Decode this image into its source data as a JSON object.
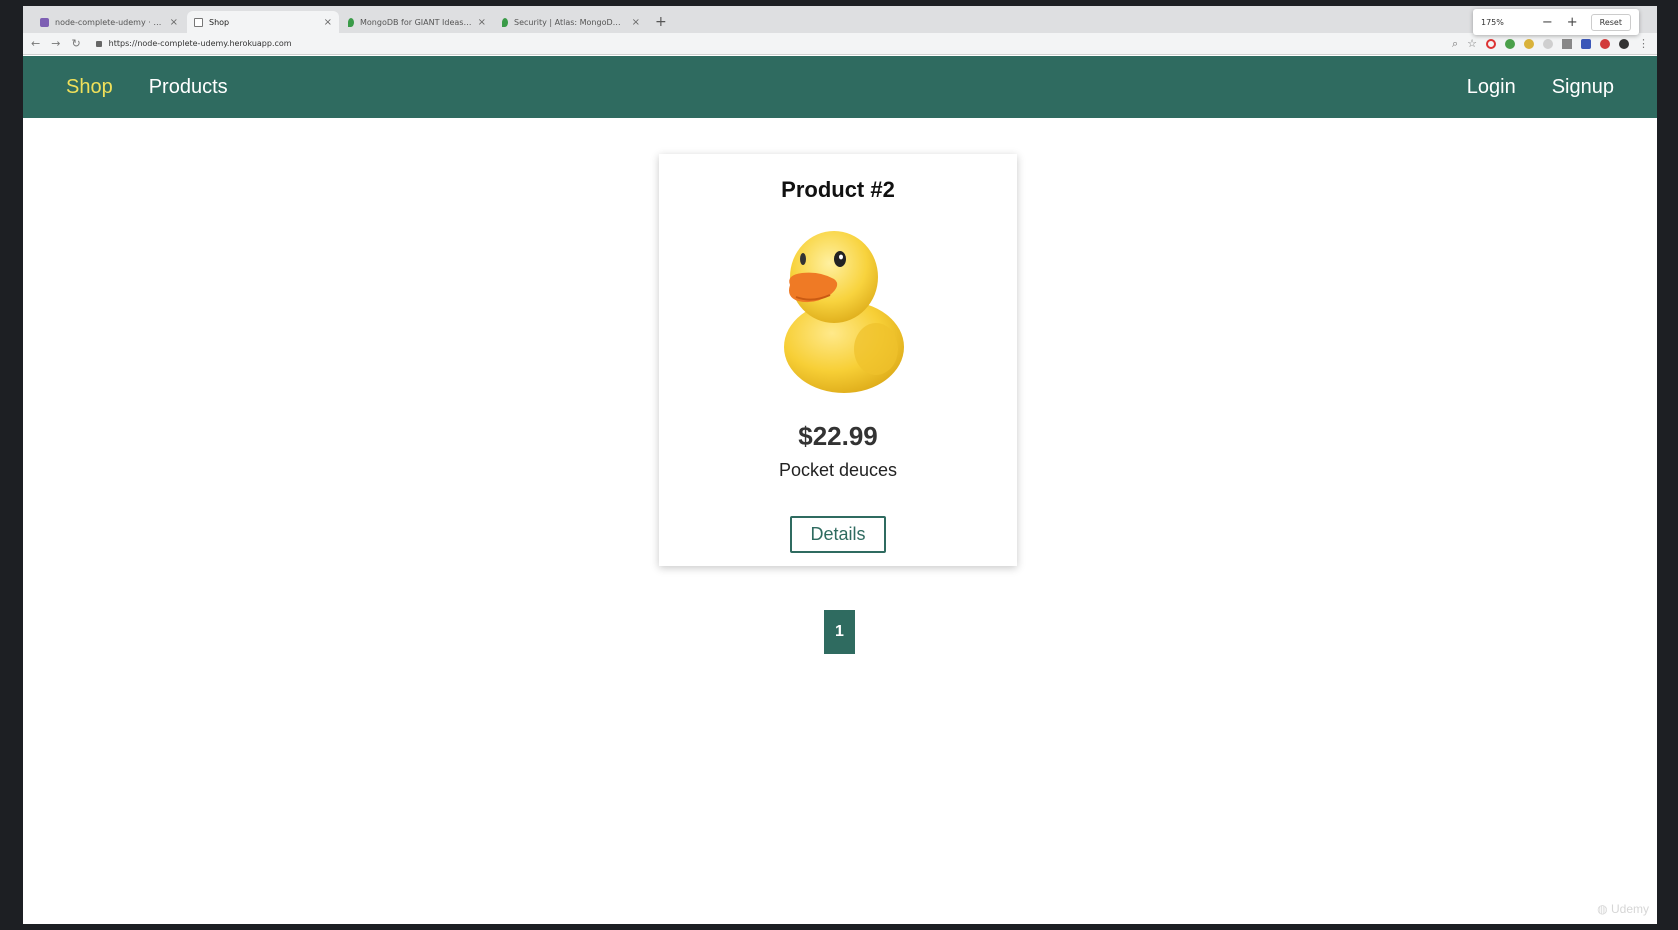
{
  "browser": {
    "tabs": [
      {
        "title": "node-complete-udemy · Reso",
        "active": false,
        "favicon": "heroku-icon"
      },
      {
        "title": "Shop",
        "active": true,
        "favicon": "page-icon"
      },
      {
        "title": "MongoDB for GIANT Ideas | M",
        "active": false,
        "favicon": "mongodb-leaf-icon"
      },
      {
        "title": "Security | Atlas: MongoDB Atl",
        "active": false,
        "favicon": "mongodb-leaf-icon"
      }
    ],
    "new_tab": "+",
    "close_glyph": "×",
    "url": "https://node-complete-udemy.herokuapp.com",
    "zoom": {
      "percent": "175%",
      "minus": "−",
      "plus": "+",
      "reset": "Reset"
    }
  },
  "nav": {
    "shop": "Shop",
    "products": "Products",
    "login": "Login",
    "signup": "Signup"
  },
  "product": {
    "title": "Product #2",
    "price": "$22.99",
    "description": "Pocket deuces",
    "details_label": "Details"
  },
  "pagination": {
    "current": "1"
  },
  "colors": {
    "nav_bg": "#2f6b60",
    "nav_active": "#f0e05a",
    "button_accent": "#2f6b60"
  }
}
